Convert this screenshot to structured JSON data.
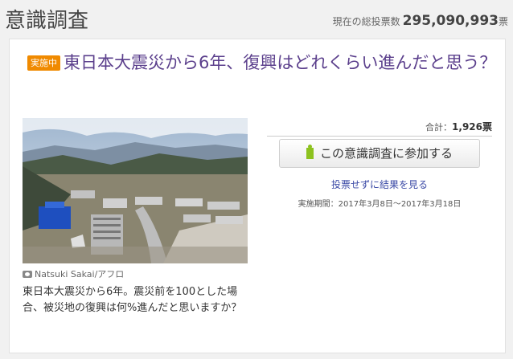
{
  "header": {
    "brand": "意識調査",
    "total_label": "現在の総投票数",
    "total_value": "295,090,993",
    "total_unit": "票"
  },
  "poll": {
    "status_badge": "実施中",
    "title": "東日本大震災から6年、復興はどれくらい進んだと思う？",
    "photo_credit": "Natsuki Sakai/アフロ",
    "description": "東日本大震災から6年。震災前を100とした場合、被災地の復興は何%進んだと思いますか？",
    "sum_label": "合計：",
    "sum_value": "1,926票",
    "join_label": "この意識調査に参加する",
    "result_link": "投票せずに結果を見る",
    "period": "実施期間：2017年3月8日〜2017年3月18日"
  },
  "icons": {
    "camera": "camera-icon",
    "join": "vote-icon"
  },
  "colors": {
    "title": "#5b3f8c",
    "badge": "#f08a00",
    "link": "#3b4aa6",
    "join_icon": "#8dc21f"
  }
}
